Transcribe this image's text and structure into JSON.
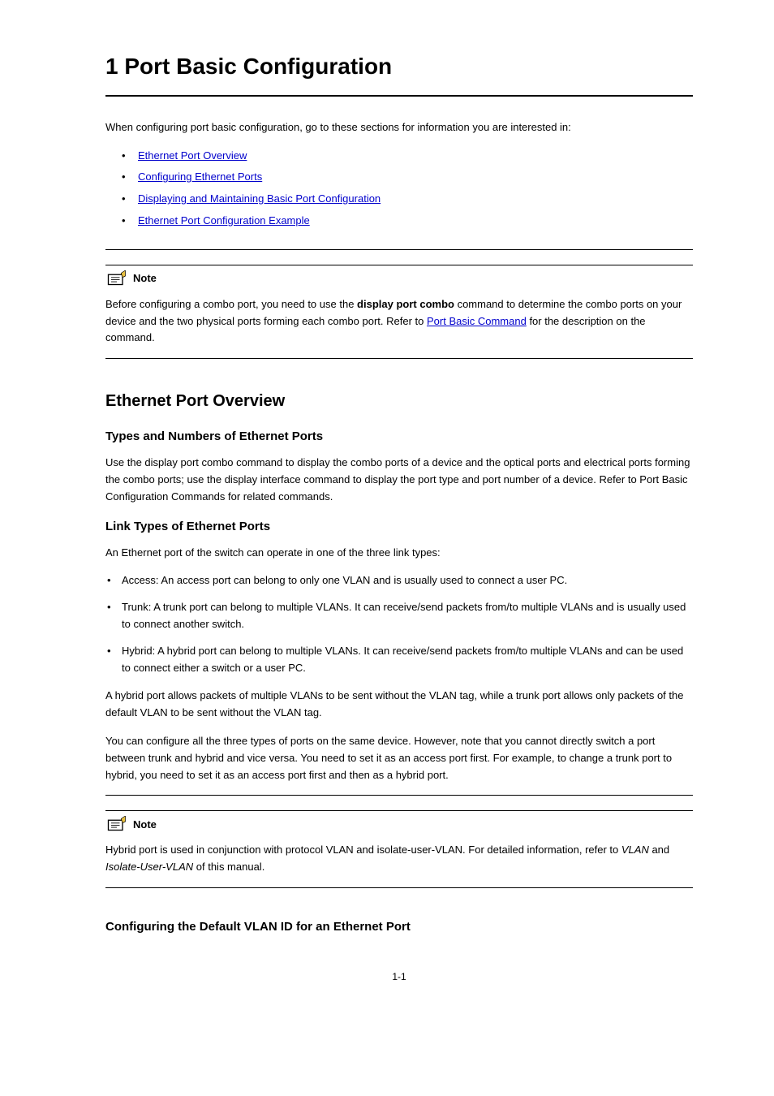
{
  "chapter_title": "1 Port Basic Configuration",
  "toc_intro": "When configuring port basic configuration, go to these sections for information you are interested in:",
  "toc_items": [
    "Ethernet Port Overview",
    "Configuring Ethernet Ports",
    "Displaying and Maintaining Basic Port Configuration",
    "Ethernet Port Configuration Example"
  ],
  "note1_label": "Note",
  "note1_body_prefix": "Before configuring a combo port, you need to use the ",
  "note1_body_bold": "display port combo",
  "note1_body_mid": " command to determine the combo ports on your device and the two physical ports forming each combo port. Refer to ",
  "note1_link": "Port Basic Command",
  "note1_body_suffix": " for the description on the command.",
  "h2_overview": "Ethernet Port Overview",
  "h3_types": "Types and Numbers of Ethernet Ports",
  "para_types": "Use the display port combo command to display the combo ports of a device and the optical ports and electrical ports forming the combo ports; use the display interface command to display the port type and port number of a device. Refer to Port Basic Configuration Commands for related commands.",
  "h3_link": "Link Types of Ethernet Ports",
  "para_link_intro": "An Ethernet port of the switch can operate in one of the three link types:",
  "link_types": [
    "Access: An access port can belong to only one VLAN and is usually used to connect a user PC.",
    "Trunk: A trunk port can belong to multiple VLANs. It can receive/send packets from/to multiple VLANs and is usually used to connect another switch.",
    "Hybrid: A hybrid port can belong to multiple VLANs. It can receive/send packets from/to multiple VLANs and can be used to connect either a switch or a user PC."
  ],
  "para_link_diff": "A hybrid port allows packets of multiple VLANs to be sent without the VLAN tag, while a trunk port allows only packets of the default VLAN to be sent without the VLAN tag.",
  "para_link_change": "You can configure all the three types of ports on the same device. However, note that you cannot directly switch a port between trunk and hybrid and vice versa. You need to set it as an access port first. For example, to change a trunk port to hybrid, you need to set it as an access port first and then as a hybrid port.",
  "note2_label": "Note",
  "note2_body_prefix": "Hybrid port is used in conjunction with protocol VLAN and isolate-user-VLAN. For detailed information, refer to ",
  "note2_italic1": "VLAN",
  "note2_mid": " and ",
  "note2_italic2": "Isolate-User-VLAN",
  "note2_body_suffix": "of this manual.",
  "h3_default": "Configuring the Default VLAN ID for an Ethernet Port",
  "page_number": "1-1"
}
